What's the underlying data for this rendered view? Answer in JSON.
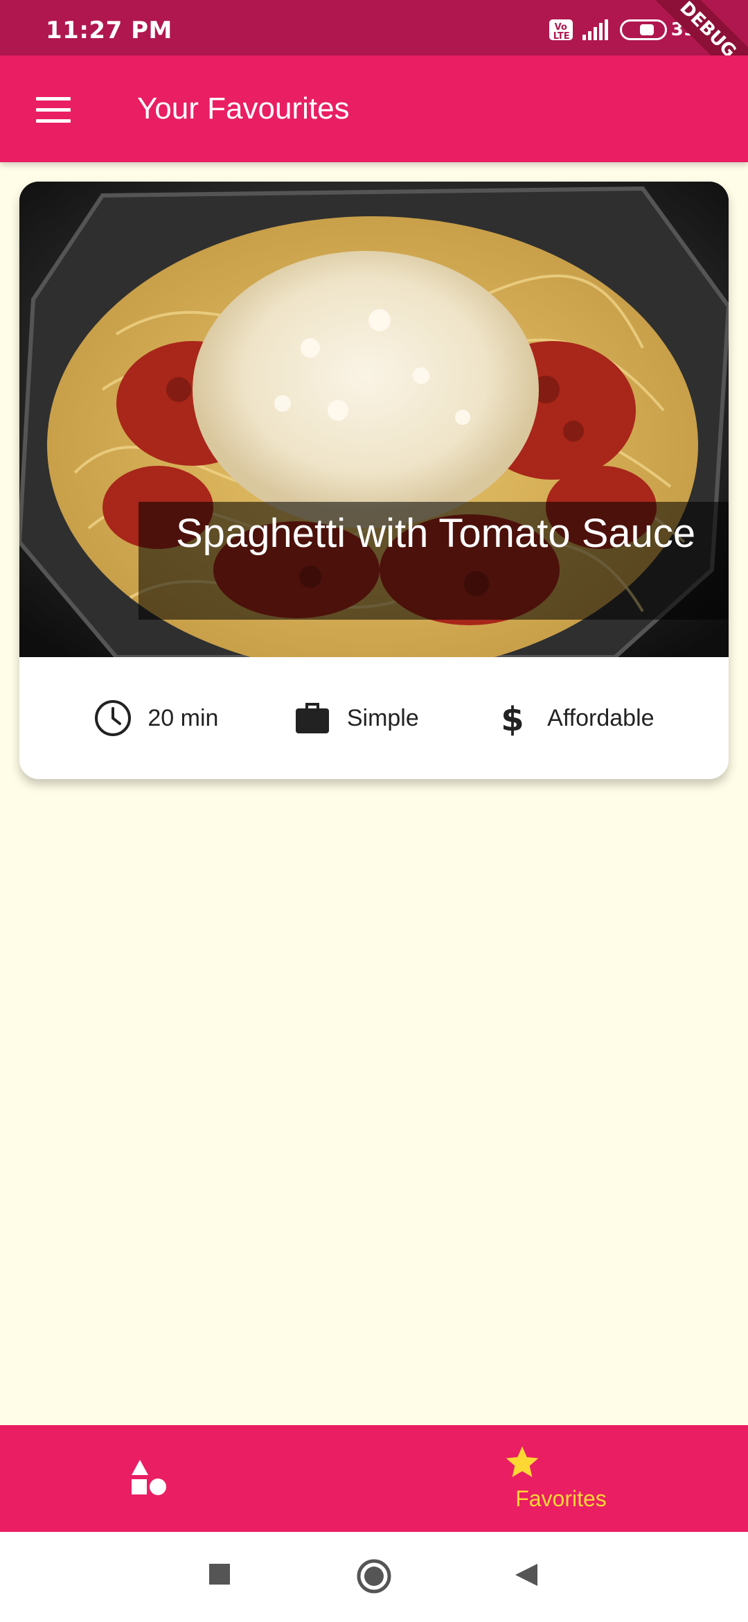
{
  "status_bar": {
    "time": "11:27 PM",
    "network_badge": "Vo LTE",
    "battery_percent": "39 %",
    "debug_label": "DEBUG"
  },
  "app_bar": {
    "menu_icon": "menu-icon",
    "title": "Your Favourites"
  },
  "favorites": [
    {
      "title": "Spaghetti with Tomato Sauce",
      "image": "spaghetti-bolognese-photo",
      "duration": "20 min",
      "complexity": "Simple",
      "affordability": "Affordable",
      "icons": {
        "duration": "clock-icon",
        "complexity": "briefcase-icon",
        "affordability": "dollar-icon"
      }
    }
  ],
  "bottom_nav": {
    "items": [
      {
        "label": "",
        "icon": "categories-shapes-icon",
        "selected": false
      },
      {
        "label": "Favorites",
        "icon": "star-icon",
        "selected": true
      }
    ],
    "active_color": "#FDD835"
  },
  "system_nav": {
    "buttons": [
      "recents-square-icon",
      "home-circle-icon",
      "back-triangle-icon"
    ]
  },
  "colors": {
    "primary": "#E91E63",
    "status_bar": "#B0174F",
    "background": "#FFFDE7",
    "accent": "#FDD835"
  }
}
